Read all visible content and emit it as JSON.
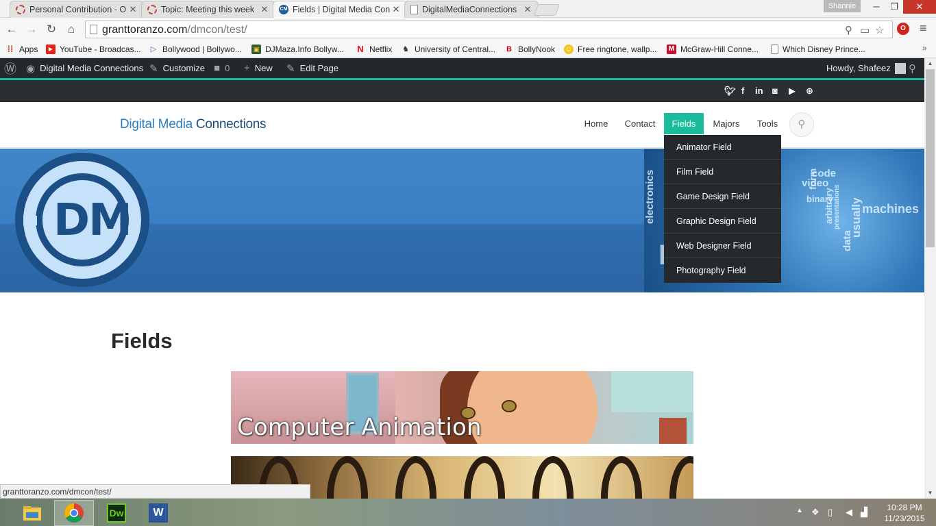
{
  "browser": {
    "tabs": [
      {
        "label": "Personal Contribution - O",
        "favicon": "loading-ring-icon"
      },
      {
        "label": "Topic: Meeting this week",
        "favicon": "loading-ring-icon"
      },
      {
        "label": "Fields | Digital Media Con",
        "favicon": "dmc-icon"
      },
      {
        "label": "DigitalMediaConnections",
        "favicon": "page-icon"
      }
    ],
    "profile_name": "Shannie",
    "url_host": "granttoranzo.com",
    "url_path": "/dmcon/test/",
    "extension_letter": "O",
    "bookmarks": [
      {
        "label": "Apps",
        "icon": "apps-grid-icon"
      },
      {
        "label": "YouTube - Broadcas...",
        "icon": "youtube-icon"
      },
      {
        "label": "Bollywood | Bollywo...",
        "icon": "play-icon"
      },
      {
        "label": "DJMaza.Info Bollyw...",
        "icon": "film-icon"
      },
      {
        "label": "Netflix",
        "icon": "netflix-icon"
      },
      {
        "label": "University of Central...",
        "icon": "pegasus-icon"
      },
      {
        "label": "BollyNook",
        "icon": "bollynook-icon"
      },
      {
        "label": "Free ringtone, wallp...",
        "icon": "ringtone-icon"
      },
      {
        "label": "McGraw-Hill Conne...",
        "icon": "mcgraw-icon"
      },
      {
        "label": "Which Disney Prince...",
        "icon": "page-icon"
      }
    ],
    "status_url": "granttoranzo.com/dmcon/test/"
  },
  "adminbar": {
    "site_name": "Digital Media Connections",
    "customize": "Customize",
    "comments_count": "0",
    "new": "New",
    "edit_page": "Edit Page",
    "howdy": "Howdy, Shafeez"
  },
  "site": {
    "logo_part1": "Digital Media",
    "logo_part2": "Connections",
    "nav": [
      "Home",
      "Contact",
      "Fields",
      "Majors",
      "Tools"
    ],
    "active_nav": "Fields",
    "dropdown": [
      "Animator Field",
      "Film Field",
      "Game Design Field",
      "Graphic Design Field",
      "Web Designer Field",
      "Photography Field"
    ],
    "hero_logo_text": "DM",
    "hero_words": [
      "electronics",
      "binary",
      "data",
      "usually",
      "machines",
      "code",
      "video",
      "form",
      "arbitrary",
      "presentations",
      "media"
    ],
    "page_title": "Fields",
    "cards": [
      {
        "label": "Computer Animation"
      },
      {
        "label": ""
      }
    ],
    "colors": {
      "accent": "#1abc9c",
      "brand_blue": "#2a7ec2",
      "brand_dark": "#1d4e7a"
    }
  },
  "taskbar": {
    "apps": [
      "file-explorer-icon",
      "chrome-icon",
      "dreamweaver-icon",
      "word-icon"
    ],
    "dreamweaver_label": "Dw",
    "word_label": "W",
    "time": "10:28 PM",
    "date": "11/23/2015"
  }
}
